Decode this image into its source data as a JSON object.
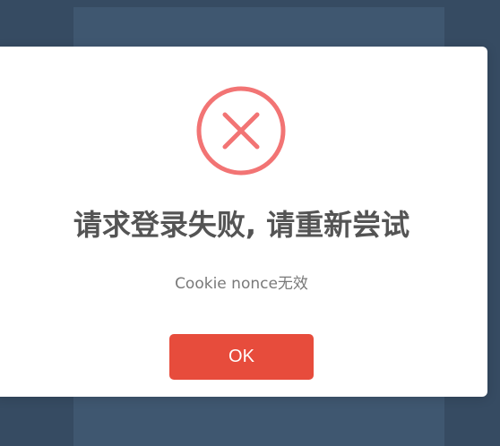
{
  "dialog": {
    "title": "请求登录失败, 请重新尝试",
    "message": "Cookie nonce无效",
    "ok_label": "OK",
    "icon": "error-x-icon"
  },
  "colors": {
    "overlay": "#364b62",
    "background_panel": "#3f5770",
    "modal": "#ffffff",
    "error_icon": "#f27474",
    "title_text": "#545454",
    "message_text": "#797979",
    "ok_button": "#e74c3c",
    "ok_text": "#ffffff"
  }
}
